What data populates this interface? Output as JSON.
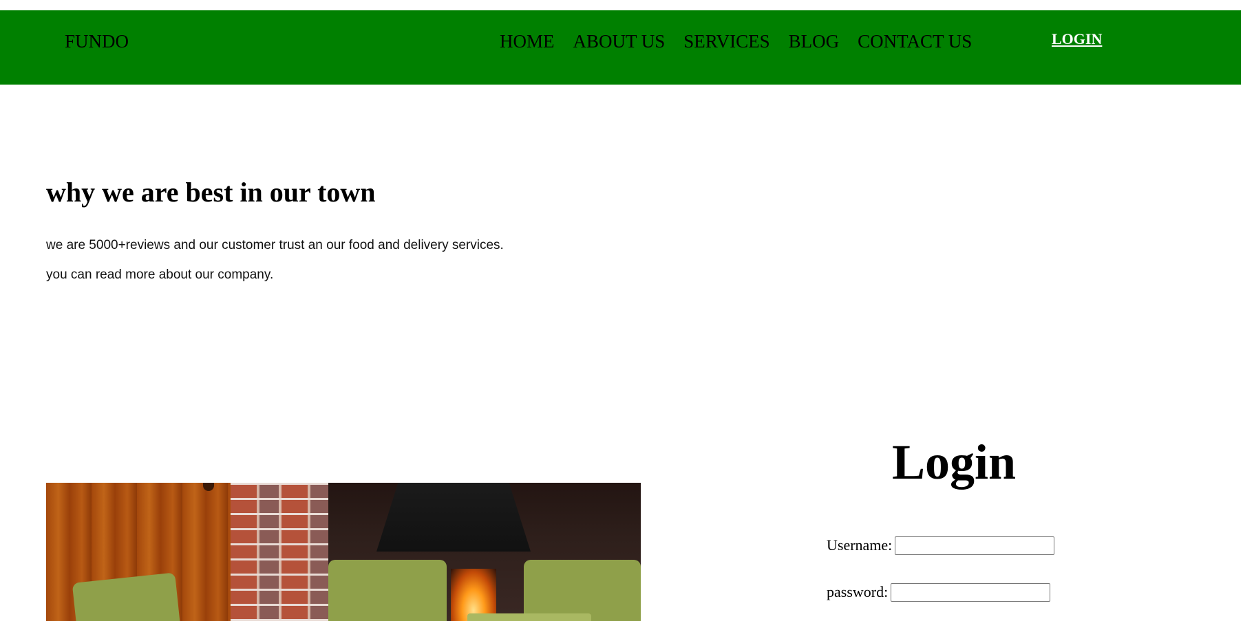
{
  "navbar": {
    "brand": "FUNDO",
    "links": [
      "HOME",
      "ABOUT US",
      "SERVICES",
      "BLOG",
      "CONTACT US"
    ],
    "login_link": "LOGIN",
    "background_color": "#008000"
  },
  "about": {
    "heading": "why we are best in our town",
    "paragraphs": [
      "we are 5000+reviews and our customer trust an our food and delivery services.",
      "you can read more about our company."
    ]
  },
  "login_form": {
    "title": "Login",
    "username_label": "Username:",
    "username_value": "",
    "password_label": "password:",
    "password_value": ""
  }
}
